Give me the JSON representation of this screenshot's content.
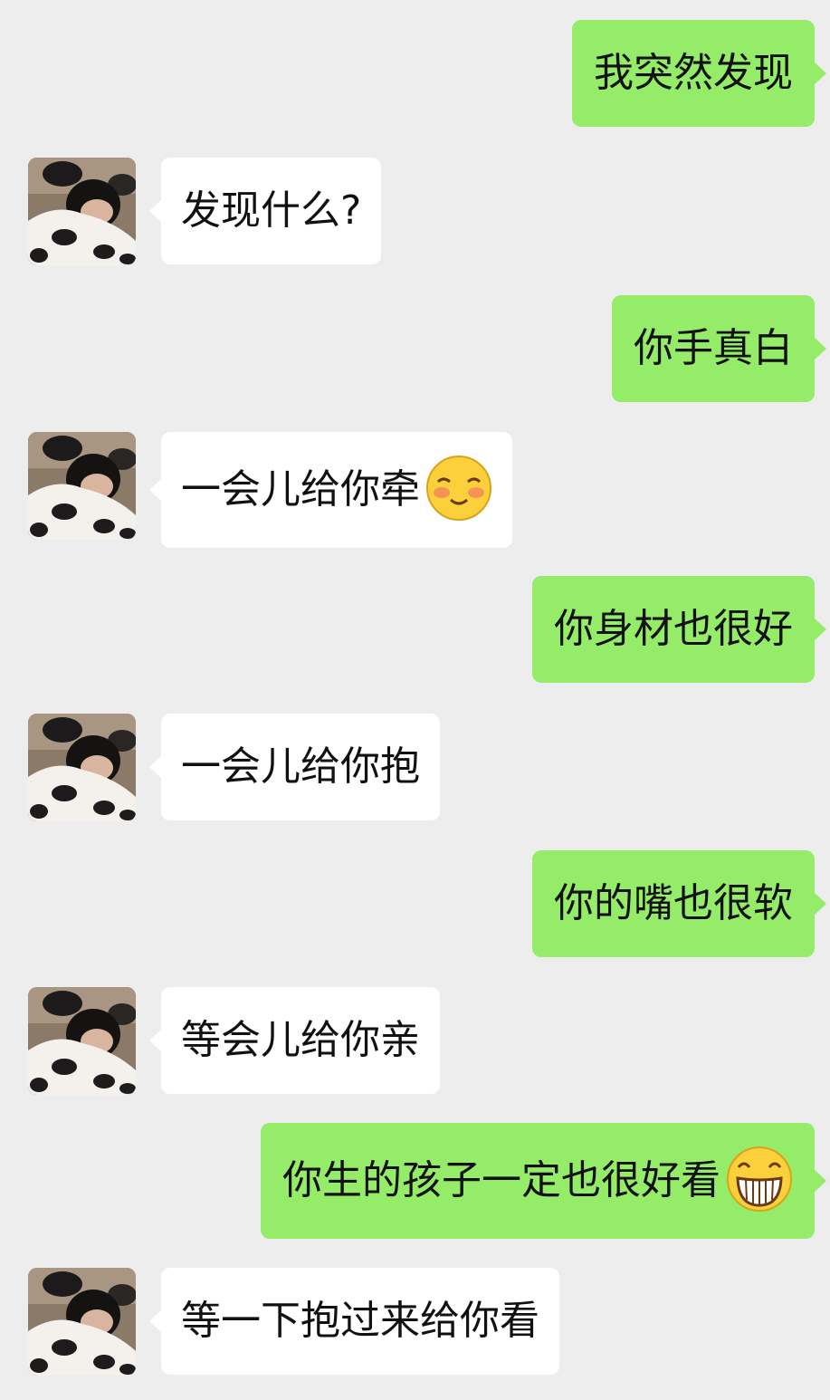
{
  "messages": [
    {
      "side": "out",
      "text": "我突然发现"
    },
    {
      "side": "in",
      "text": "发现什么?"
    },
    {
      "side": "out",
      "text": "你手真白"
    },
    {
      "side": "in",
      "text": "一会儿给你牵",
      "emoji": "shy-smile-emoji"
    },
    {
      "side": "out",
      "text": "你身材也很好"
    },
    {
      "side": "in",
      "text": "一会儿给你抱"
    },
    {
      "side": "out",
      "text": "你的嘴也很软"
    },
    {
      "side": "in",
      "text": "等会儿给你亲"
    },
    {
      "side": "out",
      "text": "你生的孩子一定也很好看",
      "emoji": "grin-emoji"
    },
    {
      "side": "in",
      "text": "等一下抱过来给你看"
    }
  ],
  "colors": {
    "background": "#ededed",
    "outgoing_bubble": "#95ec69",
    "incoming_bubble": "#ffffff",
    "text": "#111111"
  },
  "avatar": {
    "icon": "girl-with-cow-pillow-avatar"
  }
}
